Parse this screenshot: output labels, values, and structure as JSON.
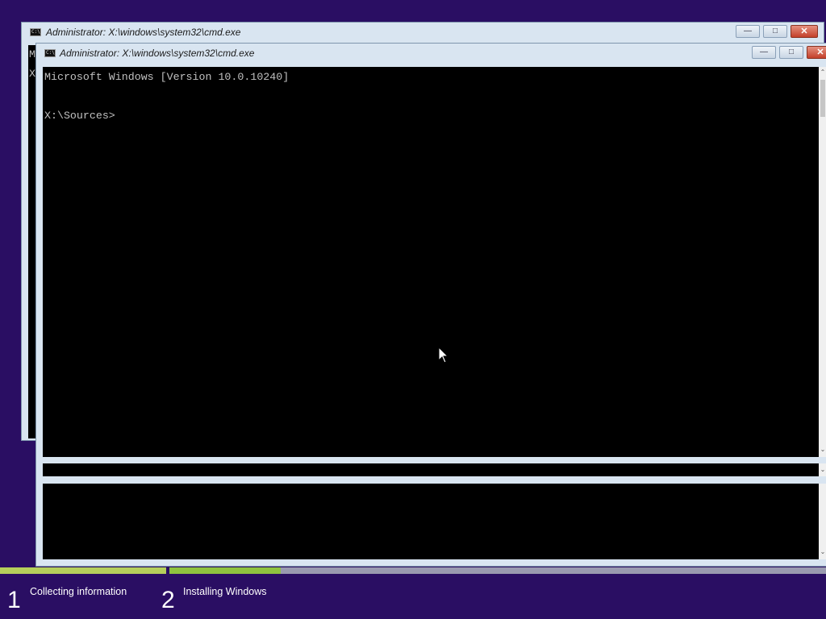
{
  "background_color": "#2a0e63",
  "back_window": {
    "title": "Administrator: X:\\windows\\system32\\cmd.exe",
    "icon": "cmd-icon",
    "visible_console_chars": [
      "M",
      "X"
    ]
  },
  "front_window": {
    "title": "Administrator: X:\\windows\\system32\\cmd.exe",
    "icon": "cmd-icon",
    "console_lines": [
      "Microsoft Windows [Version 10.0.10240]",
      "",
      "X:\\Sources>"
    ]
  },
  "caption_buttons": {
    "minimize": "minimize-icon",
    "maximize": "maximize-icon",
    "close": "close-icon"
  },
  "setup_progress": {
    "step1_fill_fraction": 1.0,
    "step2_fill_fraction": 0.17,
    "fill_color": "#8fc33f",
    "steps": [
      {
        "number": "1",
        "label": "Collecting information"
      },
      {
        "number": "2",
        "label": "Installing Windows"
      }
    ]
  }
}
